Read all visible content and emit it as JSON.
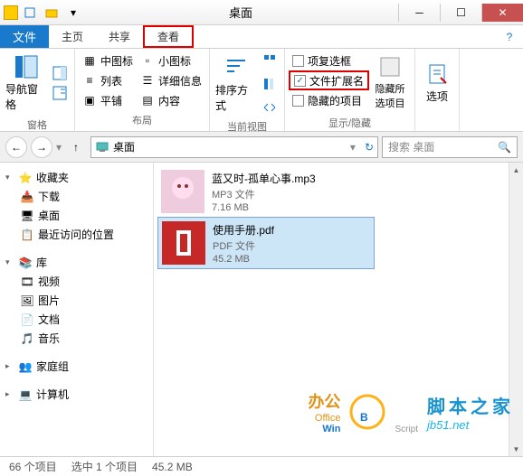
{
  "titlebar": {
    "title": "桌面"
  },
  "tabs": {
    "file": "文件",
    "home": "主页",
    "share": "共享",
    "view": "查看"
  },
  "ribbon": {
    "panes_label": "窗格",
    "nav_pane": "导航窗格",
    "layout_label": "布局",
    "icon_medium": "中图标",
    "icon_small": "小图标",
    "list": "列表",
    "details": "详细信息",
    "tiles": "平铺",
    "content": "内容",
    "current_view_label": "当前视图",
    "sort_by": "排序方式",
    "show_hide_label": "显示/隐藏",
    "item_checkboxes": "项复选框",
    "file_ext": "文件扩展名",
    "hidden_items": "隐藏的项目",
    "hide_selected": "隐藏所选项目",
    "options": "选项"
  },
  "address": {
    "location": "桌面",
    "search_placeholder": "搜索 桌面"
  },
  "tree": {
    "favorites": "收藏夹",
    "downloads": "下载",
    "desktop": "桌面",
    "recent": "最近访问的位置",
    "libraries": "库",
    "videos": "视频",
    "pictures": "图片",
    "documents": "文档",
    "music": "音乐",
    "homegroup": "家庭组",
    "computer": "计算机"
  },
  "files": [
    {
      "name": "蓝又时-孤单心事.mp3",
      "type": "MP3 文件",
      "size": "7.16 MB",
      "selected": false,
      "kind": "audio"
    },
    {
      "name": "使用手册.pdf",
      "type": "PDF 文件",
      "size": "45.2 MB",
      "selected": true,
      "kind": "pdf"
    }
  ],
  "status": {
    "count": "66 个项目",
    "selected": "选中 1 个项目",
    "size": "45.2 MB"
  },
  "watermark": {
    "office_top": "办公",
    "office_bot": "Office",
    "win": "Win",
    "script": "Script",
    "cn": "脚本之家",
    "url": "jb51.net"
  }
}
